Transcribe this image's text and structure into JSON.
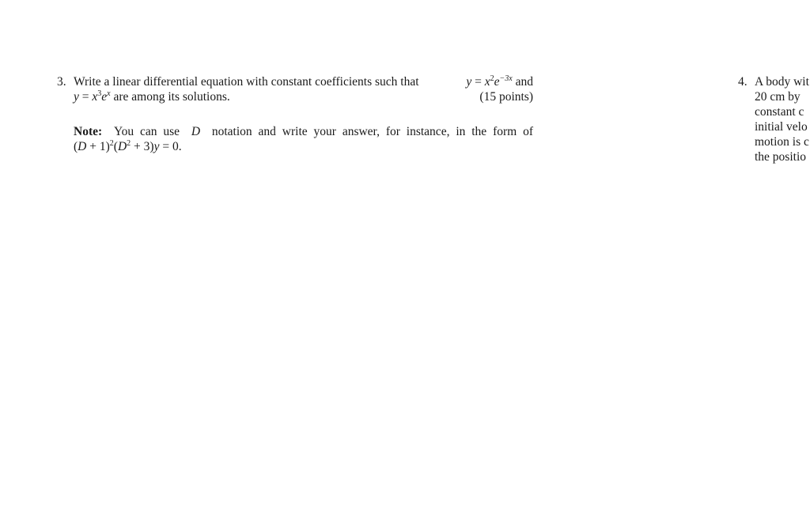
{
  "problem3": {
    "number": "3.",
    "line1_text": "Write a linear differential equation with constant coefficients such that",
    "solution1": {
      "lhs": "y",
      "eq": " = ",
      "base": "x",
      "power": "2",
      "exp_base": "e",
      "exp_power": "−3x"
    },
    "and": "and",
    "solution2": {
      "lhs": "y",
      "eq": " = ",
      "base": "x",
      "power": "3",
      "exp_base": "e",
      "exp_power": "x"
    },
    "line2_tail": " are among its solutions.",
    "points": "(15 points)",
    "note": {
      "label": "Note:",
      "text": "You can use",
      "D": "D",
      "text2": "notation and write your answer, for instance, in the form of",
      "example": {
        "open1": "(",
        "D1": "D",
        "plus1": " + 1)",
        "sq1": "2",
        "open2": "(",
        "D2": "D",
        "sq2": "2",
        "plus2": " + 3)",
        "y": "y",
        "eq": " = 0."
      }
    }
  },
  "problem4": {
    "number": "4.",
    "lines": [
      "A body wit",
      "20 cm by",
      "constant c",
      "initial velo",
      "motion is c",
      "the positio"
    ]
  }
}
